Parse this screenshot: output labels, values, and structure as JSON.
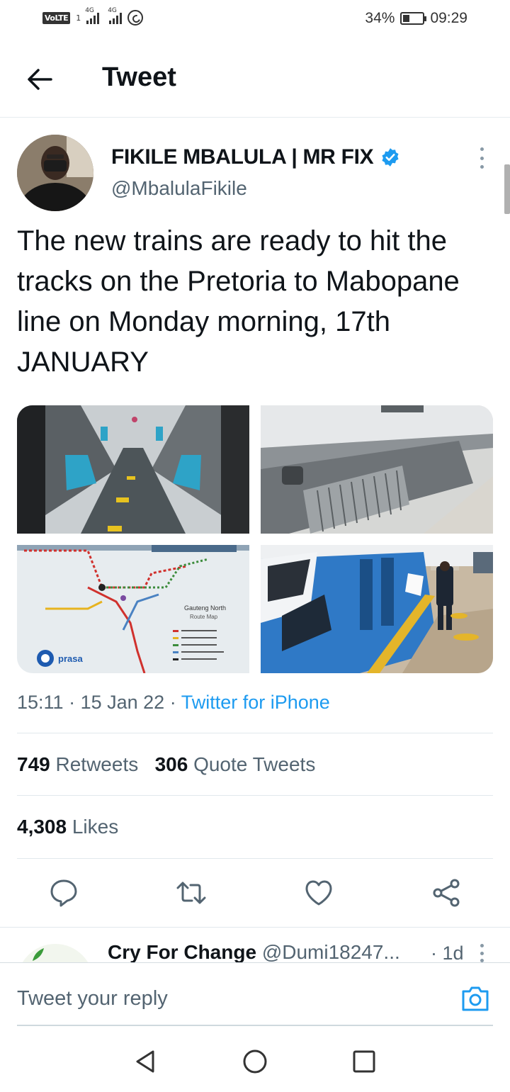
{
  "status_bar": {
    "carrier_badge": "VoLTE",
    "sim_slot": "1",
    "net_type_1": "4G",
    "net_type_2": "4G",
    "battery": "34%",
    "time": "09:29",
    "icons": [
      "signal-icon",
      "whatsapp-icon",
      "battery-icon"
    ]
  },
  "header": {
    "title": "Tweet",
    "back_icon": "back-arrow-icon"
  },
  "tweet": {
    "author_name": "FIKILE MBALULA | MR FIX",
    "author_handle": "@MbalulaFikile",
    "verified": true,
    "text": "The new trains are ready to hit the tracks on the Pretoria to Mabopane line on Monday morning, 17th JANUARY",
    "media": [
      {
        "name": "train-interior-photo"
      },
      {
        "name": "train-undercarriage-photo"
      },
      {
        "name": "route-map-photo"
      },
      {
        "name": "train-platform-photo"
      }
    ],
    "map_labels": {
      "title_line1": "Gauteng North",
      "title_line2": "Route Map",
      "brand": "prasa"
    },
    "time": "15:11",
    "date": "15 Jan 22",
    "dot1": "·",
    "dot2": "·",
    "source": "Twitter for iPhone"
  },
  "stats": {
    "retweets_count": "749",
    "retweets_label": "Retweets",
    "quotes_count": "306",
    "quotes_label": "Quote Tweets",
    "likes_count": "4,308",
    "likes_label": "Likes"
  },
  "actions": [
    "reply-icon",
    "retweet-icon",
    "like-icon",
    "share-icon"
  ],
  "reply_preview": {
    "name": "Cry For Change",
    "handle": "@Dumi18247...",
    "time": "· 1d"
  },
  "reply_bar": {
    "placeholder": "Tweet your reply"
  },
  "colors": {
    "accent": "#1d9bf0",
    "text": "#0f1419",
    "secondary": "#536471",
    "divider": "#e1e8ed"
  }
}
